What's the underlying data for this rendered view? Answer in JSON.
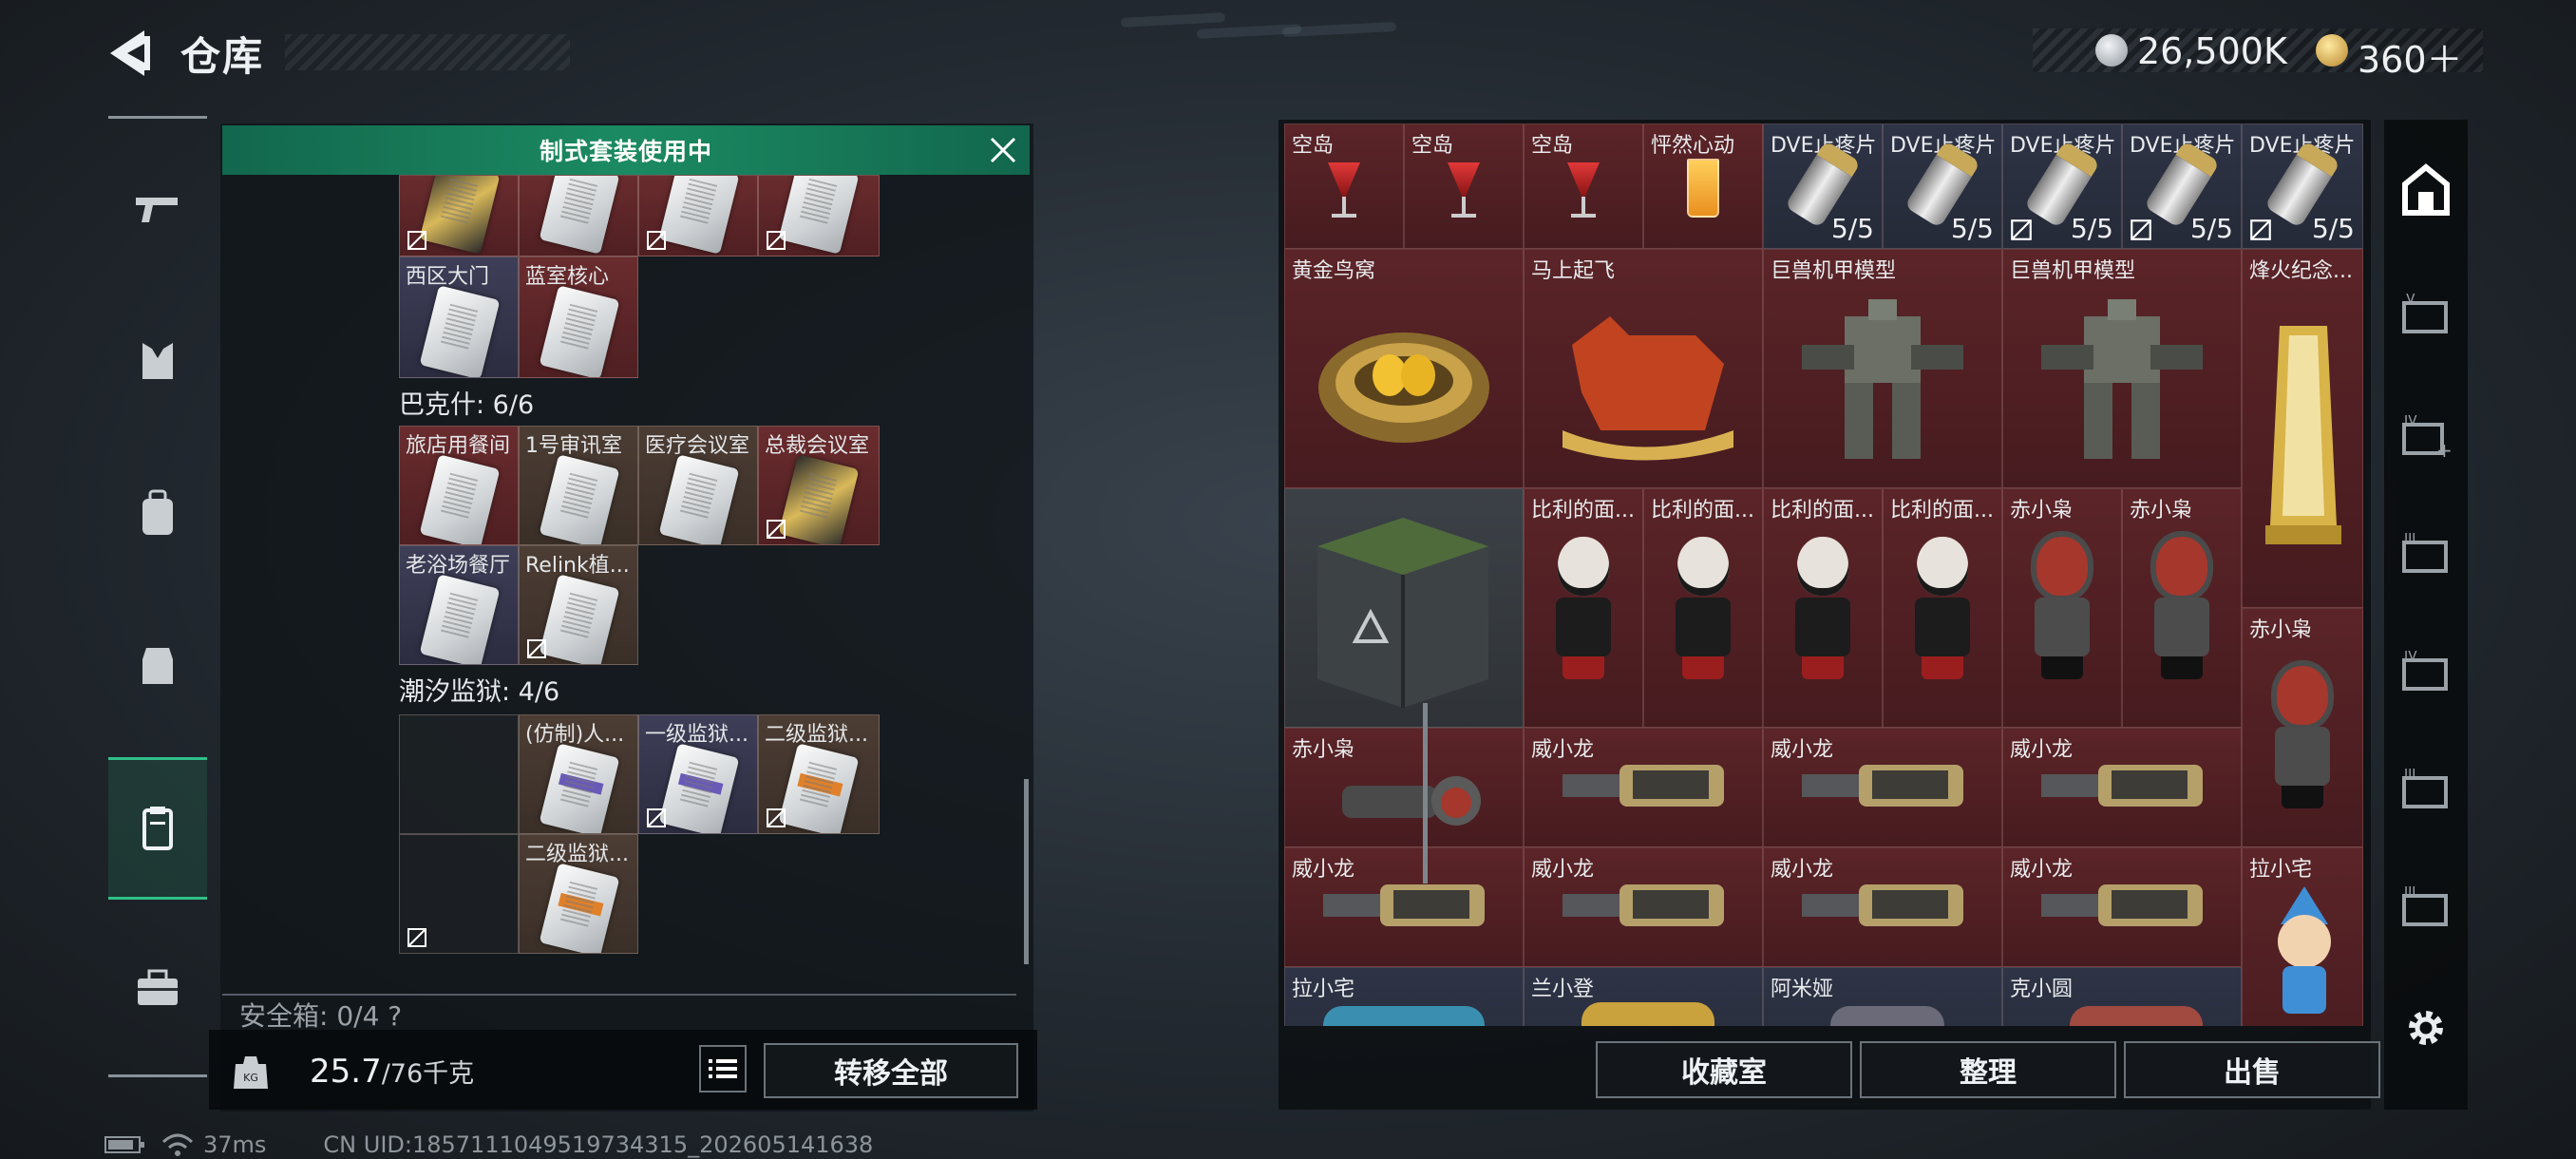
{
  "header": {
    "title": "仓库",
    "currency1": "26,500K",
    "currency2": "360＋"
  },
  "left_nav": [
    "gun-icon",
    "armor-icon",
    "backpack-icon",
    "chest-rig-icon",
    "card-case-icon",
    "toolbox-icon"
  ],
  "left": {
    "banner": "制式套装使用中",
    "top_row": [
      {
        "name": "",
        "noxfer": false
      },
      {
        "name": "",
        "noxfer": false
      },
      {
        "name": "",
        "noxfer": true
      },
      {
        "name": "",
        "noxfer": true
      }
    ],
    "row2": [
      "西区大门",
      "蓝室核心"
    ],
    "section1": "巴克什: 6/6",
    "s1_row1": [
      "旅店用餐间",
      "1号审讯室",
      "医疗会议室",
      "总裁会议室"
    ],
    "s1_row2": [
      "老浴场餐厅",
      "Relink植..."
    ],
    "section2": "潮汐监狱: 4/6",
    "s2_row1": [
      "",
      "(仿制)人...",
      "一级监狱...",
      "二级监狱..."
    ],
    "s2_row2": [
      "",
      "二级监狱..."
    ],
    "safebox": "安全箱: 0/4 ?",
    "weight_value": "25.7",
    "weight_max": "/76千克",
    "transfer_all": "转移全部"
  },
  "right": {
    "row1": [
      {
        "name": "空岛",
        "type": "cocktail",
        "count": ""
      },
      {
        "name": "空岛",
        "type": "cocktail",
        "count": ""
      },
      {
        "name": "空岛",
        "type": "cocktail",
        "count": ""
      },
      {
        "name": "怦然心动",
        "type": "juice",
        "count": ""
      },
      {
        "name": "DVE止疼片",
        "type": "pill",
        "count": "5/5"
      },
      {
        "name": "DVE止疼片",
        "type": "pill",
        "count": "5/5"
      },
      {
        "name": "DVE止疼片",
        "type": "pill",
        "count": "5/5"
      },
      {
        "name": "DVE止疼片",
        "type": "pill",
        "count": "5/5"
      },
      {
        "name": "DVE止疼片",
        "type": "pill",
        "count": "5/5"
      }
    ],
    "row2": [
      "黄金鸟窝",
      "马上起飞",
      "巨兽机甲模型",
      "巨兽机甲模型",
      "烽火纪念..."
    ],
    "row3": [
      "",
      "比利的面...",
      "比利的面...",
      "比利的面...",
      "比利的面...",
      "赤小枭",
      "赤小枭",
      "赤小枭"
    ],
    "row4": [
      "赤小枭",
      "威小龙",
      "威小龙",
      "威小龙"
    ],
    "row5": [
      "威小龙",
      "威小龙",
      "威小龙",
      "威小龙",
      "拉小宅"
    ],
    "row6": [
      "拉小宅",
      "兰小登",
      "阿米娅",
      "克小圆"
    ],
    "buttons": {
      "collect": "收藏室",
      "organize": "整理",
      "sell": "出售"
    }
  },
  "status": {
    "latency": "37ms",
    "uid": "CN UID:1857111049519734315_202605141638"
  }
}
